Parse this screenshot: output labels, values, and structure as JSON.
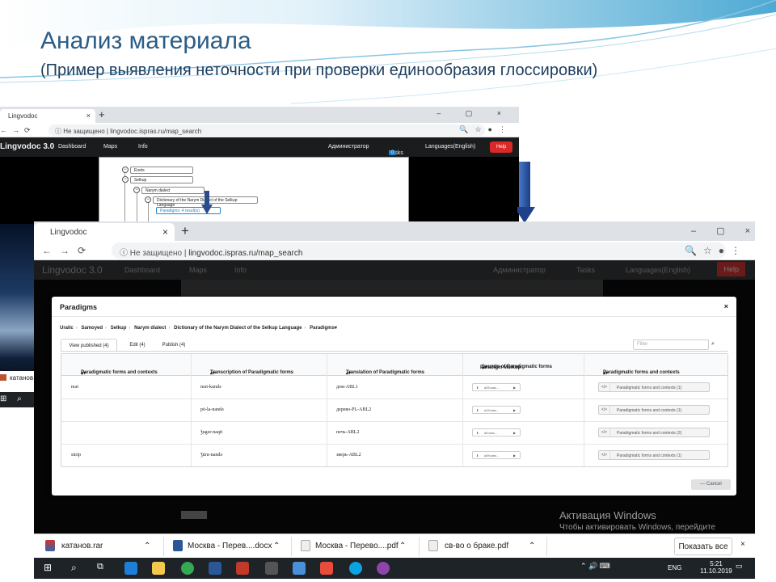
{
  "slide": {
    "title": "Анализ материала",
    "subtitle": "(Пример выявления неточности при проверки единообразия глоссировки)"
  },
  "bg_browser": {
    "tab_title": "Lingvodoc",
    "url_security": "Не защищено",
    "url": "lingvodoc.ispras.ru/map_search",
    "nav": {
      "logo": "Lingvodoc 3.0",
      "items": [
        "Dashboard",
        "Maps",
        "Info"
      ],
      "admin": "Администратор",
      "tasks": "Tasks",
      "tasks_badge": "0",
      "languages": "Languages(English)",
      "help": "Help"
    },
    "tree": {
      "enets": "Enets",
      "selkup": "Selkup",
      "narym": "Narym dialect",
      "dictionary": "Dictionary of the Narym Dialect of the Selkup Language",
      "paradigms": "Paradigms: 4 result(s)"
    }
  },
  "left_desktop": {
    "file_label": "катанов.ra"
  },
  "browser": {
    "tab_title": "Lingvodoc",
    "tab_close": "×",
    "new_tab": "+",
    "url_security": "Не защищено",
    "url": "lingvodoc.ispras.ru/map_search",
    "nav": {
      "logo": "Lingvodoc 3.0",
      "items": [
        "Dashboard",
        "Maps",
        "Info"
      ],
      "admin": "Администратор",
      "tasks": "Tasks",
      "languages": "Languages(English)",
      "help": "Help"
    }
  },
  "modal": {
    "title": "Paradigms",
    "close": "×",
    "breadcrumb": [
      "Uralic",
      "Samoyed",
      "Selkup",
      "Narym dialect",
      "Dictionary of the Narym Dialect of the Selkup Language",
      "Paradigms"
    ],
    "tabs": [
      "View published (4)",
      "Edit (4)",
      "Publish (4)"
    ],
    "filter_placeholder": "Filter",
    "columns": [
      "Paradigmatic forms and contexts",
      "Transcription of Paradigmatic forms",
      "Translation of Paradigmatic forms",
      "Sounds of Paradigmatic forms",
      "Paradigm Markup",
      "Paradigmatic forms and contexts"
    ],
    "rows": [
      {
        "form": "mǝt",
        "transcription": "mǝt-kundǝ",
        "translation": "дом-ABL1",
        "audio": "a25.wav...",
        "contexts": "Paradigmatic forms and contexts (1)"
      },
      {
        "form": "",
        "transcription": "pō-la-nandǝ",
        "translation": "дерево-PL-ABL2",
        "audio": "a19.wav...",
        "contexts": "Paradigmatic forms and contexts (1)"
      },
      {
        "form": "",
        "transcription": "ǯugǝr-naqit",
        "translation": "печь-ABL2",
        "audio": "a9.wav...",
        "contexts": "Paradigmatic forms and contexts (2)"
      },
      {
        "form": "sūrip",
        "transcription": "ǯūru-nandǝ",
        "translation": "зверь-ABL2",
        "audio": "a39.wav...",
        "contexts": "Paradigmatic forms and contexts (1)"
      }
    ],
    "cancel": "Cancel"
  },
  "activation": {
    "title": "Активация Windows",
    "text": "Чтобы активировать Windows, перейдите в раздел \"Параметры\"."
  },
  "downloads": {
    "items": [
      "катанов.rar",
      "Москва - Перев....docx",
      "Москва - Перево....pdf",
      "св-во о браке.pdf"
    ],
    "show_all": "Показать все",
    "close": "×"
  },
  "taskbar": {
    "lang": "ENG",
    "time": "5:21",
    "date": "11.10.2019"
  },
  "colors": {
    "title": "#2a5d87",
    "help_red": "#db2828",
    "nav_dark": "#1b1c1d",
    "tasks_badge": "#2185d0"
  }
}
